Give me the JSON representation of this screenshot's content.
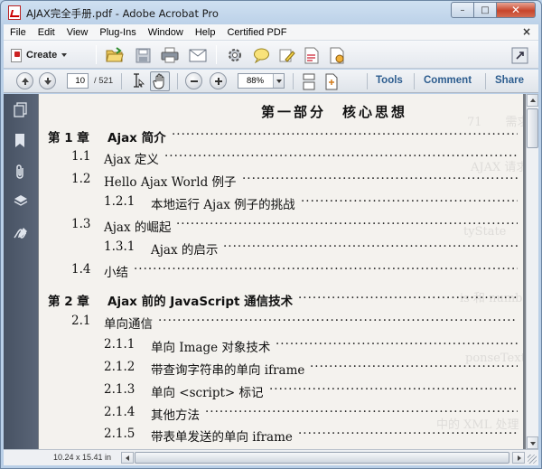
{
  "window": {
    "title": "AJAX完全手册.pdf - Adobe Acrobat Pro",
    "minimize": "–",
    "maximize": "□",
    "close": "✕"
  },
  "menu": {
    "items": [
      "File",
      "Edit",
      "View",
      "Plug-Ins",
      "Window",
      "Help",
      "Certified PDF"
    ],
    "close_glyph": "×"
  },
  "toolbar": {
    "create_label": "Create",
    "icons": [
      "open-folder-icon",
      "save-icon",
      "print-icon",
      "email-icon",
      "settings-icon",
      "comment-icon",
      "highlight-icon",
      "document-icon",
      "sign-icon",
      "expand-icon"
    ]
  },
  "navigation": {
    "current_page": "10",
    "total_pages": "/ 521",
    "zoom": "88%",
    "tabs": [
      "Tools",
      "Comment",
      "Share"
    ]
  },
  "document": {
    "part_title": "第一部分　核心思想",
    "toc": [
      {
        "num": "第 1 章",
        "text": "Ajax 简介",
        "chapter": true
      },
      {
        "num": "1.1",
        "text": "Ajax 定义",
        "chapter": false
      },
      {
        "num": "1.2",
        "text": "Hello Ajax World 例子",
        "chapter": false
      },
      {
        "num": "1.2.1",
        "text": "本地运行 Ajax 例子的挑战",
        "chapter": false
      },
      {
        "num": "1.3",
        "text": "Ajax 的崛起",
        "chapter": false
      },
      {
        "num": "1.3.1",
        "text": "Ajax 的启示",
        "chapter": false
      },
      {
        "num": "1.4",
        "text": "小结",
        "chapter": false
      },
      {
        "num": "第 2 章",
        "text": "Ajax 前的 JavaScript 通信技术",
        "chapter": true
      },
      {
        "num": "2.1",
        "text": "单向通信",
        "chapter": false
      },
      {
        "num": "2.1.1",
        "text": "单向 Image 对象技术",
        "chapter": false
      },
      {
        "num": "2.1.2",
        "text": "带查询字符串的单向 iframe",
        "chapter": false
      },
      {
        "num": "2.1.3",
        "text": "单向 <script> 标记",
        "chapter": false
      },
      {
        "num": "2.1.4",
        "text": "其他方法",
        "chapter": false
      },
      {
        "num": "2.1.5",
        "text": "带表单发送的单向 iframe",
        "chapter": false
      }
    ]
  },
  "status": {
    "page_size": "10.24 x 15.41 in"
  }
}
